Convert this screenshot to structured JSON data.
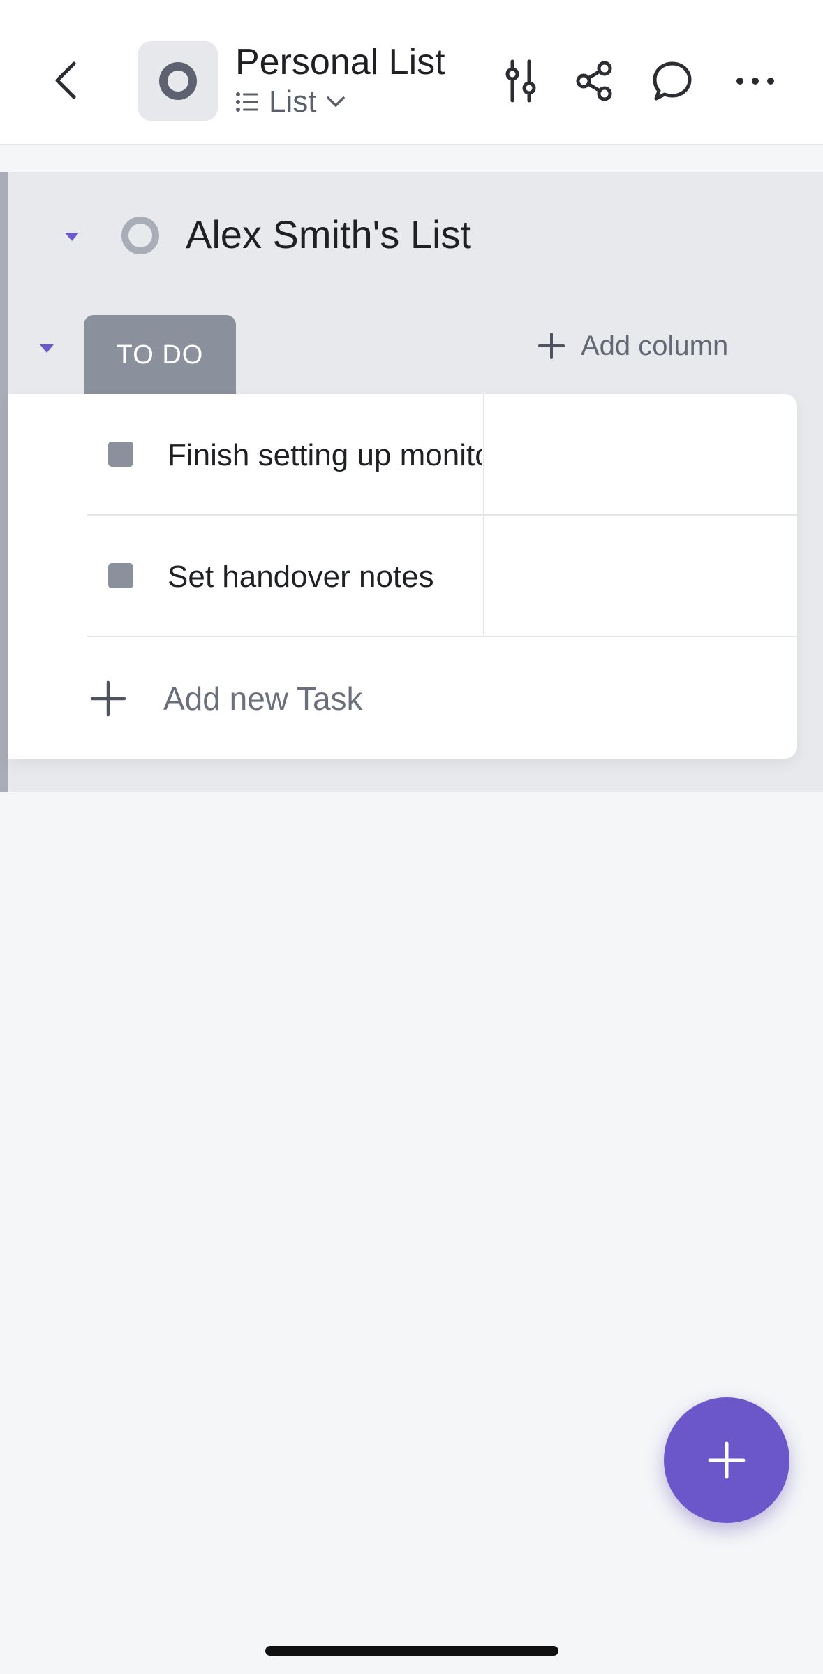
{
  "header": {
    "title": "Personal List",
    "view_label": "List"
  },
  "group": {
    "title": "Alex Smith's List",
    "status_label": "TO DO",
    "add_column_label": "Add column"
  },
  "tasks": [
    {
      "name": "Finish setting up monitors"
    },
    {
      "name": "Set handover notes"
    }
  ],
  "add_task_label": "Add new Task",
  "colors": {
    "accent": "#6b57c9",
    "status_todo": "#8b909d"
  },
  "icons": {
    "back": "chevron-left-icon",
    "filter": "sliders-icon",
    "share": "share-icon",
    "comment": "chat-bubble-icon",
    "more": "more-horizontal-icon",
    "fab": "plus-icon"
  }
}
